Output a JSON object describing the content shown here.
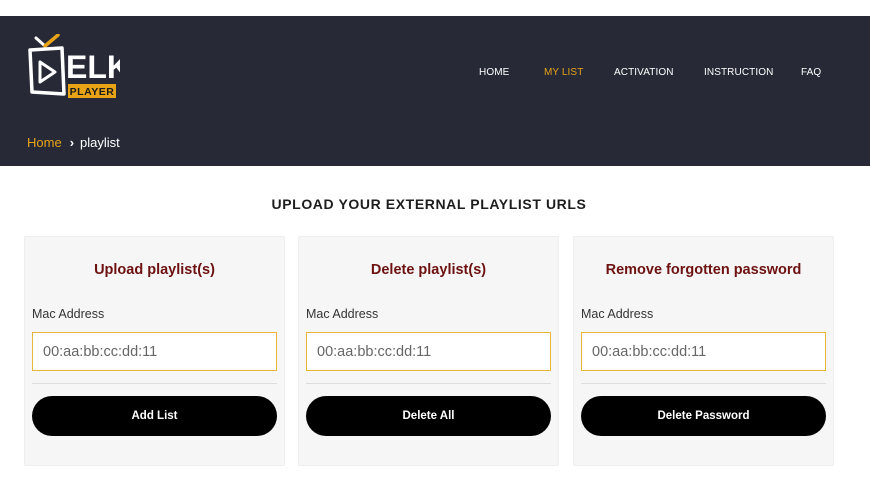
{
  "logo": {
    "brand_text": "ELK",
    "badge_text": "PLAYER",
    "colors": {
      "accent": "#e8a317",
      "primary": "#ffffff"
    }
  },
  "nav": {
    "items": [
      {
        "label": "HOME",
        "active": false
      },
      {
        "label": "MY LIST",
        "active": true
      },
      {
        "label": "ACTIVATION",
        "active": false
      },
      {
        "label": "INSTRUCTION",
        "active": false
      },
      {
        "label": "FAQ",
        "active": false
      }
    ]
  },
  "breadcrumb": {
    "home": "Home",
    "separator": "›",
    "current": "playlist"
  },
  "section": {
    "title": "UPLOAD YOUR EXTERNAL PLAYLIST URLS"
  },
  "cards": [
    {
      "title": "Upload playlist(s)",
      "label": "Mac Address",
      "placeholder": "00:aa:bb:cc:dd:11",
      "button": "Add List"
    },
    {
      "title": "Delete playlist(s)",
      "label": "Mac Address",
      "placeholder": "00:aa:bb:cc:dd:11",
      "button": "Delete All"
    },
    {
      "title": "Remove forgotten password",
      "label": "Mac Address",
      "placeholder": "00:aa:bb:cc:dd:11",
      "button": "Delete Password"
    }
  ],
  "colors": {
    "header_bg": "#272a36",
    "accent": "#e8a317",
    "card_title": "#6e1111",
    "button_bg": "#000000"
  }
}
